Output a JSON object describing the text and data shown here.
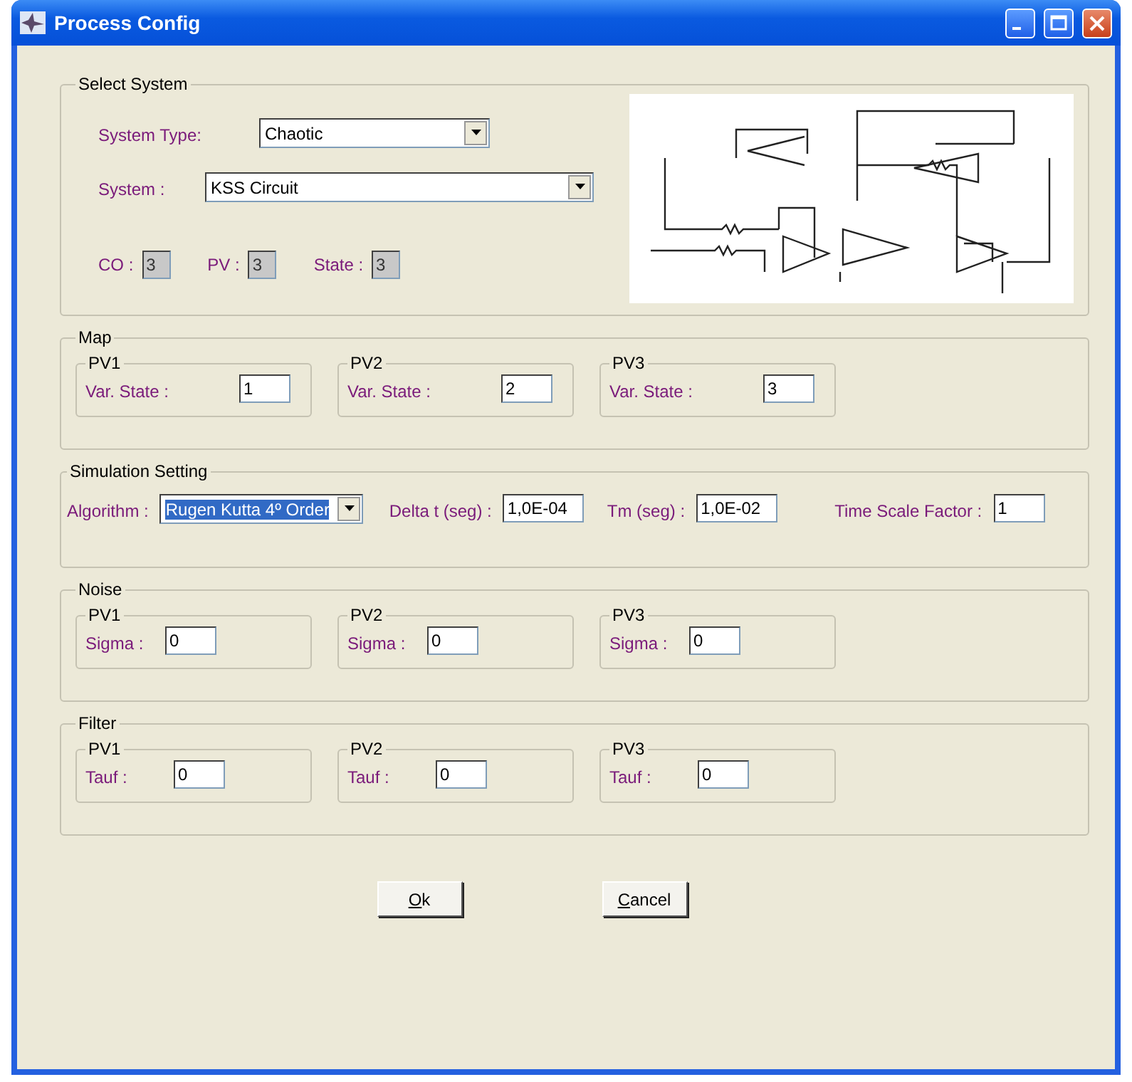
{
  "window": {
    "title": "Process Config"
  },
  "select_system": {
    "title": "Select System",
    "system_type": {
      "label": "System Type:",
      "value": "Chaotic"
    },
    "system": {
      "label": "System :",
      "value": "KSS Circuit"
    },
    "counts": [
      {
        "label": "CO :",
        "value": "3",
        "disabled": true
      },
      {
        "label": "PV :",
        "value": "3",
        "disabled": true
      },
      {
        "label": "State :",
        "value": "3",
        "disabled": true
      }
    ]
  },
  "map": {
    "title": "Map",
    "groups": [
      {
        "title": "PV1",
        "label": "Var. State :",
        "value": "1"
      },
      {
        "title": "PV2",
        "label": "Var. State :",
        "value": "2"
      },
      {
        "title": "PV3",
        "label": "Var. State :",
        "value": "3"
      }
    ]
  },
  "simulation": {
    "title": "Simulation Setting",
    "fields": [
      {
        "kind": "select",
        "label": "Algorithm :",
        "value": "Rugen Kutta 4º Order",
        "highlighted": true
      },
      {
        "kind": "text",
        "label": "Delta t (seg) :",
        "value": "1,0E-04"
      },
      {
        "kind": "text",
        "label": "Tm (seg) :",
        "value": "1,0E-02"
      },
      {
        "kind": "text",
        "label": "Time Scale Factor :",
        "value": "1"
      }
    ]
  },
  "noise": {
    "title": "Noise",
    "groups": [
      {
        "title": "PV1",
        "label": "Sigma :",
        "value": "0"
      },
      {
        "title": "PV2",
        "label": "Sigma :",
        "value": "0"
      },
      {
        "title": "PV3",
        "label": "Sigma :",
        "value": "0"
      }
    ]
  },
  "filter": {
    "title": "Filter",
    "groups": [
      {
        "title": "PV1",
        "label": "Tauf :",
        "value": "0"
      },
      {
        "title": "PV2",
        "label": "Tauf :",
        "value": "0"
      },
      {
        "title": "PV3",
        "label": "Tauf :",
        "value": "0"
      }
    ]
  },
  "buttons": [
    {
      "label": "Ok",
      "mnemonic": true
    },
    {
      "label": "Cancel",
      "mnemonic": true
    }
  ]
}
